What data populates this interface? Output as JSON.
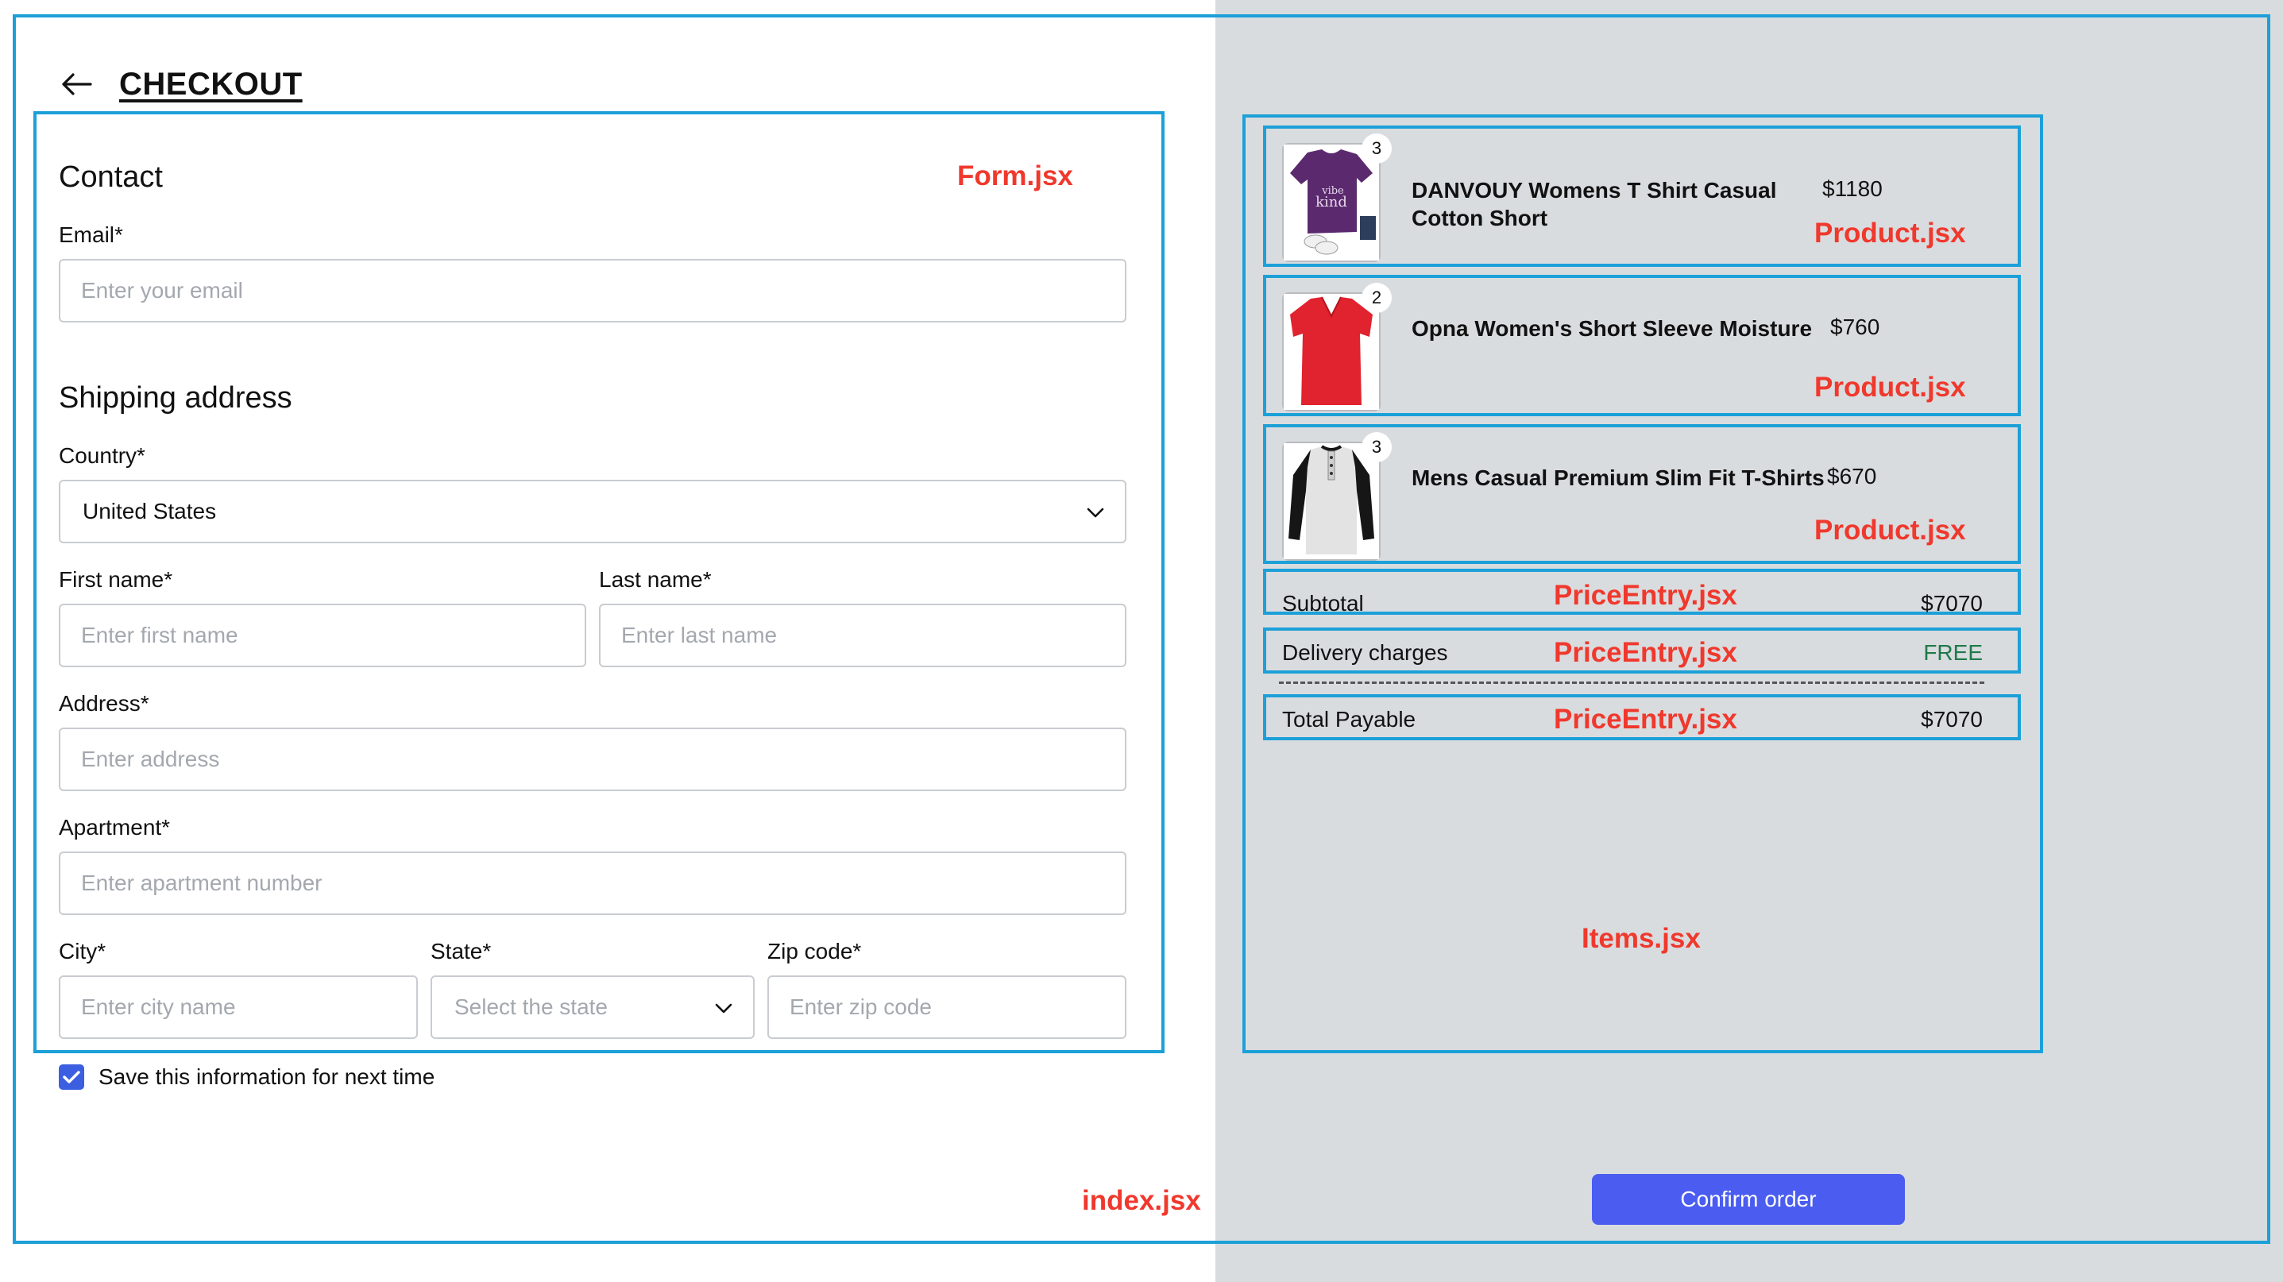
{
  "header": {
    "title": "CHECKOUT",
    "back_icon": "arrow-left-icon"
  },
  "form": {
    "contact_heading": "Contact",
    "email_label": "Email*",
    "email_placeholder": "Enter your email",
    "shipping_heading": "Shipping address",
    "country_label": "Country*",
    "country_value": "United States",
    "first_name_label": "First name*",
    "first_name_placeholder": "Enter first name",
    "last_name_label": "Last name*",
    "last_name_placeholder": "Enter last name",
    "address_label": "Address*",
    "address_placeholder": "Enter address",
    "apartment_label": "Apartment*",
    "apartment_placeholder": "Enter apartment number",
    "city_label": "City*",
    "city_placeholder": "Enter city name",
    "state_label": "State*",
    "state_placeholder": "Select the state",
    "zip_label": "Zip code*",
    "zip_placeholder": "Enter zip code",
    "save_info_label": "Save this information for next time",
    "save_info_checked": true
  },
  "products": [
    {
      "name_line1": "DANVOUY Womens T Shirt Casual",
      "name_line2": "Cotton Short",
      "price": "$1180",
      "qty": "3",
      "image_icon": "purple-tshirt-image"
    },
    {
      "name_line1": "Opna Women's Short Sleeve Moisture",
      "name_line2": "",
      "price": "$760",
      "qty": "2",
      "image_icon": "red-tshirt-image"
    },
    {
      "name_line1": "Mens Casual Premium Slim Fit T-Shirts",
      "name_line2": "",
      "price": "$670",
      "qty": "3",
      "image_icon": "raglan-tshirt-image"
    }
  ],
  "prices": {
    "subtotal_label": "Subtotal",
    "subtotal_value": "$7070",
    "delivery_label": "Delivery charges",
    "delivery_value": "FREE",
    "total_label": "Total Payable",
    "total_value": "$7070"
  },
  "confirm_label": "Confirm order",
  "annotations": {
    "form": "Form.jsx",
    "product": "Product.jsx",
    "price_entry": "PriceEntry.jsx",
    "items": "Items.jsx",
    "index": "index.jsx"
  },
  "colors": {
    "annotation_border": "#1ca0d8",
    "annotation_text": "#f0382d",
    "right_panel_bg": "#d9dcdf",
    "accent": "#4a5df0",
    "free_text": "#1e7a4a"
  }
}
